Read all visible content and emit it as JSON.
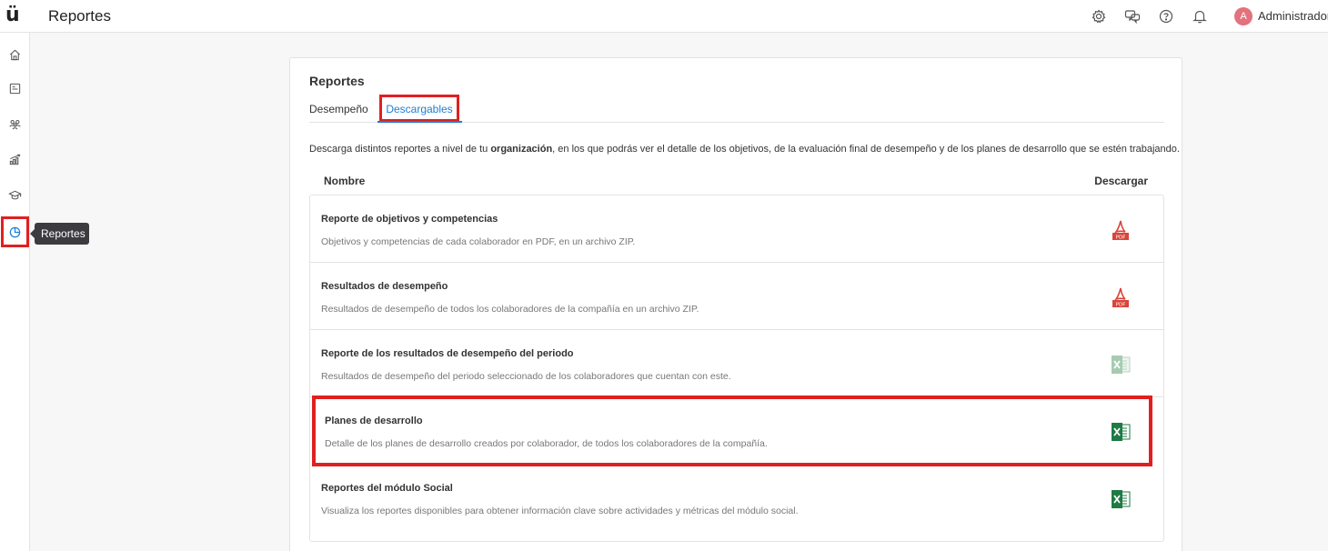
{
  "header": {
    "logo": "ü",
    "title": "Reportes",
    "icons": [
      "settings-icon",
      "chat-icon",
      "help-icon",
      "bell-icon"
    ],
    "user": {
      "initial": "A",
      "name": "Administrador",
      "avatar_color": "#e2727c"
    }
  },
  "sidebar": {
    "items": [
      {
        "icon": "home-icon"
      },
      {
        "icon": "calendar-icon"
      },
      {
        "icon": "people-icon"
      },
      {
        "icon": "growth-chart-icon"
      },
      {
        "icon": "graduation-cap-icon"
      },
      {
        "icon": "pie-chart-icon",
        "active": true
      }
    ],
    "tooltip": "Reportes"
  },
  "card": {
    "title": "Reportes",
    "tabs": [
      {
        "label": "Desempeño",
        "active": false
      },
      {
        "label": "Descargables",
        "active": true
      }
    ],
    "description_pre": "Descarga distintos reportes a nivel de tu ",
    "description_bold": "organización",
    "description_post": ", en los que podrás ver el detalle de los objetivos, de la evaluación final de desempeño y de los planes de desarrollo que se estén trabajando.",
    "col_name": "Nombre",
    "col_download": "Descargar",
    "rows": [
      {
        "title": "Reporte de objetivos y competencias",
        "subtitle": "Objetivos y competencias de cada colaborador en PDF, en un archivo ZIP.",
        "icon": "pdf-icon"
      },
      {
        "title": "Resultados de desempeño",
        "subtitle": "Resultados de desempeño de todos los colaboradores de la compañía en un archivo ZIP.",
        "icon": "pdf-icon"
      },
      {
        "title": "Reporte de los resultados de desempeño del periodo",
        "subtitle": "Resultados de desempeño del periodo seleccionado de los colaboradores que cuentan con este.",
        "icon": "excel-icon-disabled"
      },
      {
        "title": "Planes de desarrollo",
        "subtitle": "Detalle de los planes de desarrollo creados por colaborador, de todos los colaboradores de la compañía.",
        "icon": "excel-icon"
      },
      {
        "title": "Reportes del módulo Social",
        "subtitle": "Visualiza los reportes disponibles para obtener información clave sobre actividades y métricas del módulo social.",
        "icon": "excel-icon"
      }
    ],
    "pdf_label": "PDF"
  },
  "colors": {
    "accent": "#1a7fd6",
    "highlight": "#e02020",
    "pdf_red": "#d9443b",
    "excel_green": "#1f7a44"
  }
}
